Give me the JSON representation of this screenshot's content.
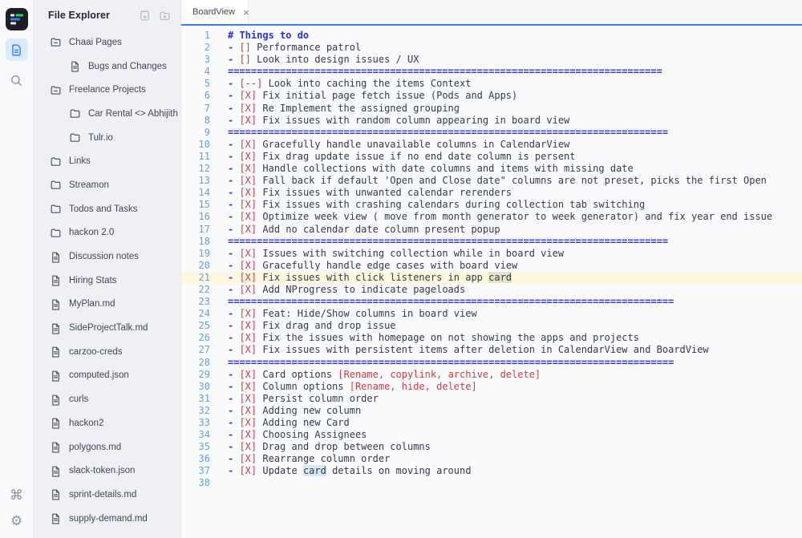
{
  "app": {
    "accent_blue": "#3c7df2",
    "active_icon_blue": "#3b82f6",
    "active_icon_bg": "#dbeafe",
    "logo_colors": {
      "bg": "#1c2026",
      "green": "#34c46b",
      "blue": "#2e7fe8",
      "light": "#e4e7ea"
    }
  },
  "rail": {
    "items": [
      {
        "name": "app-logo",
        "icon": "logo"
      },
      {
        "name": "files-button",
        "icon": "document",
        "active": true
      },
      {
        "name": "search-button",
        "icon": "search"
      }
    ],
    "bottom": [
      {
        "name": "command-button",
        "glyph": "⌘"
      },
      {
        "name": "settings-button",
        "glyph": "⚙"
      }
    ]
  },
  "explorer": {
    "title": "File Explorer",
    "actions": [
      {
        "name": "new-file-button",
        "icon": "file-plus"
      },
      {
        "name": "new-folder-button",
        "icon": "folder-plus"
      }
    ],
    "items": [
      {
        "label": "Chaai Pages",
        "icon": "folder-open",
        "indent": 0
      },
      {
        "label": "Bugs and Changes",
        "icon": "file",
        "indent": 1
      },
      {
        "label": "Freelance Projects",
        "icon": "folder-open",
        "indent": 0
      },
      {
        "label": "Car Rental <> Abhijith",
        "icon": "folder",
        "indent": 1
      },
      {
        "label": "Tulr.io",
        "icon": "folder",
        "indent": 1
      },
      {
        "label": "Links",
        "icon": "folder",
        "indent": 0
      },
      {
        "label": "Streamon",
        "icon": "folder",
        "indent": 0
      },
      {
        "label": "Todos and Tasks",
        "icon": "folder",
        "indent": 0
      },
      {
        "label": "hackon 2.0",
        "icon": "folder",
        "indent": 0
      },
      {
        "label": "Discussion notes",
        "icon": "file",
        "indent": 0
      },
      {
        "label": "Hiring Stats",
        "icon": "file",
        "indent": 0
      },
      {
        "label": "MyPlan.md",
        "icon": "file",
        "indent": 0
      },
      {
        "label": "SideProjectTalk.md",
        "icon": "file",
        "indent": 0
      },
      {
        "label": "carzoo-creds",
        "icon": "file",
        "indent": 0
      },
      {
        "label": "computed.json",
        "icon": "file",
        "indent": 0
      },
      {
        "label": "curls",
        "icon": "file",
        "indent": 0
      },
      {
        "label": "hackon2",
        "icon": "file",
        "indent": 0
      },
      {
        "label": "polygons.md",
        "icon": "file",
        "indent": 0
      },
      {
        "label": "slack-token.json",
        "icon": "file",
        "indent": 0
      },
      {
        "label": "sprint-details.md",
        "icon": "file",
        "indent": 0
      },
      {
        "label": "supply-demand.md",
        "icon": "file",
        "indent": 0
      }
    ]
  },
  "editor": {
    "tab": {
      "label": "BoardView",
      "close_glyph": "×"
    },
    "active_line": 21,
    "lines": [
      {
        "n": 1,
        "parts": [
          [
            "h",
            "# Things to do"
          ]
        ]
      },
      {
        "n": 2,
        "parts": [
          [
            "b",
            "- "
          ],
          [
            "x",
            "[]"
          ],
          [
            "t",
            " Performance patrol"
          ]
        ]
      },
      {
        "n": 3,
        "parts": [
          [
            "b",
            "- "
          ],
          [
            "x",
            "[]"
          ],
          [
            "t",
            " Look into design issues / UX"
          ]
        ]
      },
      {
        "n": 4,
        "parts": [
          [
            "s",
            "==========================================================================="
          ]
        ]
      },
      {
        "n": 5,
        "parts": [
          [
            "b",
            "- "
          ],
          [
            "x",
            "[--]"
          ],
          [
            "t",
            " Look into caching the items Context"
          ]
        ]
      },
      {
        "n": 6,
        "parts": [
          [
            "b",
            "- "
          ],
          [
            "x",
            "[X]"
          ],
          [
            "t",
            " Fix initial page fetch issue (Pods and Apps)"
          ]
        ]
      },
      {
        "n": 7,
        "parts": [
          [
            "b",
            "- "
          ],
          [
            "x",
            "[X]"
          ],
          [
            "t",
            " Re Implement the assigned grouping"
          ]
        ]
      },
      {
        "n": 8,
        "parts": [
          [
            "b",
            "- "
          ],
          [
            "x",
            "[X]"
          ],
          [
            "t",
            " Fix issues with random column appearing in board view"
          ]
        ]
      },
      {
        "n": 9,
        "parts": [
          [
            "s",
            "============================================================================"
          ]
        ]
      },
      {
        "n": 10,
        "parts": [
          [
            "b",
            "- "
          ],
          [
            "x",
            "[X]"
          ],
          [
            "t",
            " Gracefully handle unavailable columns in CalendarView"
          ]
        ]
      },
      {
        "n": 11,
        "parts": [
          [
            "b",
            "- "
          ],
          [
            "x",
            "[X]"
          ],
          [
            "t",
            " Fix drag update issue if no end date column is persent"
          ]
        ]
      },
      {
        "n": 12,
        "parts": [
          [
            "b",
            "- "
          ],
          [
            "x",
            "[X]"
          ],
          [
            "t",
            " Handle collections with date columns and items with missing date"
          ]
        ]
      },
      {
        "n": 13,
        "parts": [
          [
            "b",
            "- "
          ],
          [
            "x",
            "[X]"
          ],
          [
            "t",
            " Fall back if default 'Open and Close date\" columns are not preset, picks the first Open"
          ]
        ]
      },
      {
        "n": 14,
        "parts": [
          [
            "b",
            "- "
          ],
          [
            "x",
            "[X]"
          ],
          [
            "t",
            " Fix issues with unwanted calendar rerenders"
          ]
        ]
      },
      {
        "n": 15,
        "parts": [
          [
            "b",
            "- "
          ],
          [
            "x",
            "[X]"
          ],
          [
            "t",
            " Fix issues with crashing calendars during collection tab switching"
          ]
        ]
      },
      {
        "n": 16,
        "parts": [
          [
            "b",
            "- "
          ],
          [
            "x",
            "[X]"
          ],
          [
            "t",
            " Optimize week view ( move from month generator to week generator) and fix year end issue"
          ]
        ]
      },
      {
        "n": 17,
        "parts": [
          [
            "b",
            "- "
          ],
          [
            "x",
            "[X]"
          ],
          [
            "t",
            " Add no calendar date column present popup"
          ]
        ]
      },
      {
        "n": 18,
        "parts": [
          [
            "s",
            "============================================================================"
          ]
        ]
      },
      {
        "n": 19,
        "parts": [
          [
            "b",
            "- "
          ],
          [
            "x",
            "[X]"
          ],
          [
            "t",
            " Issues with switching collection while in board view"
          ]
        ]
      },
      {
        "n": 20,
        "parts": [
          [
            "b",
            "- "
          ],
          [
            "x",
            "[X]"
          ],
          [
            "t",
            " Gracefully handle edge cases with board view"
          ]
        ]
      },
      {
        "n": 21,
        "parts": [
          [
            "b",
            "- "
          ],
          [
            "x",
            "[X]"
          ],
          [
            "t",
            " Fix issues with click listeners in app "
          ],
          [
            "m",
            "card"
          ]
        ]
      },
      {
        "n": 22,
        "parts": [
          [
            "b",
            "- "
          ],
          [
            "x",
            "[X]"
          ],
          [
            "t",
            " Add NProgress to indicate pageloads"
          ]
        ]
      },
      {
        "n": 23,
        "parts": [
          [
            "s",
            "============================================================================="
          ]
        ]
      },
      {
        "n": 24,
        "parts": [
          [
            "b",
            "- "
          ],
          [
            "x",
            "[X]"
          ],
          [
            "t",
            " Feat: Hide/Show columns in board view"
          ]
        ]
      },
      {
        "n": 25,
        "parts": [
          [
            "b",
            "- "
          ],
          [
            "x",
            "[X]"
          ],
          [
            "t",
            " Fix drag and drop issue"
          ]
        ]
      },
      {
        "n": 26,
        "parts": [
          [
            "b",
            "- "
          ],
          [
            "x",
            "[X]"
          ],
          [
            "t",
            " Fix the issues with homepage on not showing the apps and projects"
          ]
        ]
      },
      {
        "n": 27,
        "parts": [
          [
            "b",
            "- "
          ],
          [
            "x",
            "[X]"
          ],
          [
            "t",
            " Fix issues with persistent items after deletion in CalendarView and BoardView"
          ]
        ]
      },
      {
        "n": 28,
        "parts": [
          [
            "s",
            "============================================================================="
          ]
        ]
      },
      {
        "n": 29,
        "parts": [
          [
            "b",
            "- "
          ],
          [
            "x",
            "[X]"
          ],
          [
            "t",
            " Card options "
          ],
          [
            "r",
            "[Rename, copylink, archive, delete]"
          ]
        ]
      },
      {
        "n": 30,
        "parts": [
          [
            "b",
            "- "
          ],
          [
            "x",
            "[X]"
          ],
          [
            "t",
            " Column options "
          ],
          [
            "r",
            "[Rename, hide, delete]"
          ]
        ]
      },
      {
        "n": 31,
        "parts": [
          [
            "b",
            "- "
          ],
          [
            "x",
            "[X]"
          ],
          [
            "t",
            " Persist column order"
          ]
        ]
      },
      {
        "n": 32,
        "parts": [
          [
            "b",
            "- "
          ],
          [
            "x",
            "[X]"
          ],
          [
            "t",
            " Adding new column"
          ]
        ]
      },
      {
        "n": 33,
        "parts": [
          [
            "b",
            "- "
          ],
          [
            "x",
            "[X]"
          ],
          [
            "t",
            " Adding new Card"
          ]
        ]
      },
      {
        "n": 34,
        "parts": [
          [
            "b",
            "- "
          ],
          [
            "x",
            "[X]"
          ],
          [
            "t",
            " Choosing Assignees"
          ]
        ]
      },
      {
        "n": 35,
        "parts": [
          [
            "b",
            "- "
          ],
          [
            "x",
            "[X]"
          ],
          [
            "t",
            " Drag and drop between columns"
          ]
        ]
      },
      {
        "n": 36,
        "parts": [
          [
            "b",
            "- "
          ],
          [
            "x",
            "[X]"
          ],
          [
            "t",
            " Rearrange column order"
          ]
        ]
      },
      {
        "n": 37,
        "parts": [
          [
            "b",
            "- "
          ],
          [
            "x",
            "[X]"
          ],
          [
            "t",
            " Update "
          ],
          [
            "n2",
            "card"
          ],
          [
            "t",
            " details on moving around"
          ]
        ]
      },
      {
        "n": 38,
        "parts": []
      }
    ]
  }
}
